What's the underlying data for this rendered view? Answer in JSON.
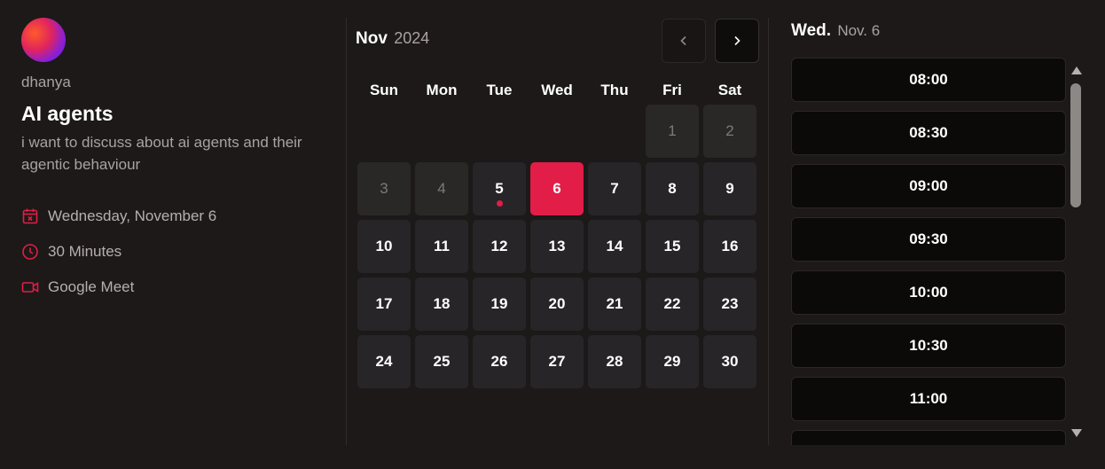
{
  "host": {
    "username": "dhanya"
  },
  "event": {
    "title": "AI agents",
    "description": "i want to discuss about ai agents and their agentic behaviour",
    "date_text": "Wednesday, November 6",
    "duration_text": "30 Minutes",
    "location_text": "Google Meet"
  },
  "calendar": {
    "month": "Nov",
    "year": "2024",
    "weekdays": [
      "Sun",
      "Mon",
      "Tue",
      "Wed",
      "Thu",
      "Fri",
      "Sat"
    ],
    "start_weekday_index": 5,
    "days": [
      {
        "day": "1",
        "state": "disabled"
      },
      {
        "day": "2",
        "state": "disabled"
      },
      {
        "day": "3",
        "state": "disabled"
      },
      {
        "day": "4",
        "state": "disabled"
      },
      {
        "day": "5",
        "state": "today"
      },
      {
        "day": "6",
        "state": "selected"
      },
      {
        "day": "7",
        "state": "available"
      },
      {
        "day": "8",
        "state": "available"
      },
      {
        "day": "9",
        "state": "available"
      },
      {
        "day": "10",
        "state": "available"
      },
      {
        "day": "11",
        "state": "available"
      },
      {
        "day": "12",
        "state": "available"
      },
      {
        "day": "13",
        "state": "available"
      },
      {
        "day": "14",
        "state": "available"
      },
      {
        "day": "15",
        "state": "available"
      },
      {
        "day": "16",
        "state": "available"
      },
      {
        "day": "17",
        "state": "available"
      },
      {
        "day": "18",
        "state": "available"
      },
      {
        "day": "19",
        "state": "available"
      },
      {
        "day": "20",
        "state": "available"
      },
      {
        "day": "21",
        "state": "available"
      },
      {
        "day": "22",
        "state": "available"
      },
      {
        "day": "23",
        "state": "available"
      },
      {
        "day": "24",
        "state": "available"
      },
      {
        "day": "25",
        "state": "available"
      },
      {
        "day": "26",
        "state": "available"
      },
      {
        "day": "27",
        "state": "available"
      },
      {
        "day": "28",
        "state": "available"
      },
      {
        "day": "29",
        "state": "available"
      },
      {
        "day": "30",
        "state": "available"
      }
    ]
  },
  "time_slots": {
    "day_label": "Wed.",
    "date_label": "Nov. 6",
    "slots": [
      "08:00",
      "08:30",
      "09:00",
      "09:30",
      "10:00",
      "10:30",
      "11:00",
      ""
    ]
  },
  "icons": {
    "date": "calendar-icon",
    "duration": "clock-icon",
    "location": "video-camera-icon",
    "prev": "chevron-left-icon",
    "next": "chevron-right-icon"
  },
  "colors": {
    "accent": "#e11d48",
    "background": "#1c1918",
    "day_cell": "#272528",
    "slot": "#0c0a09",
    "muted_text": "#a8a3a0"
  }
}
